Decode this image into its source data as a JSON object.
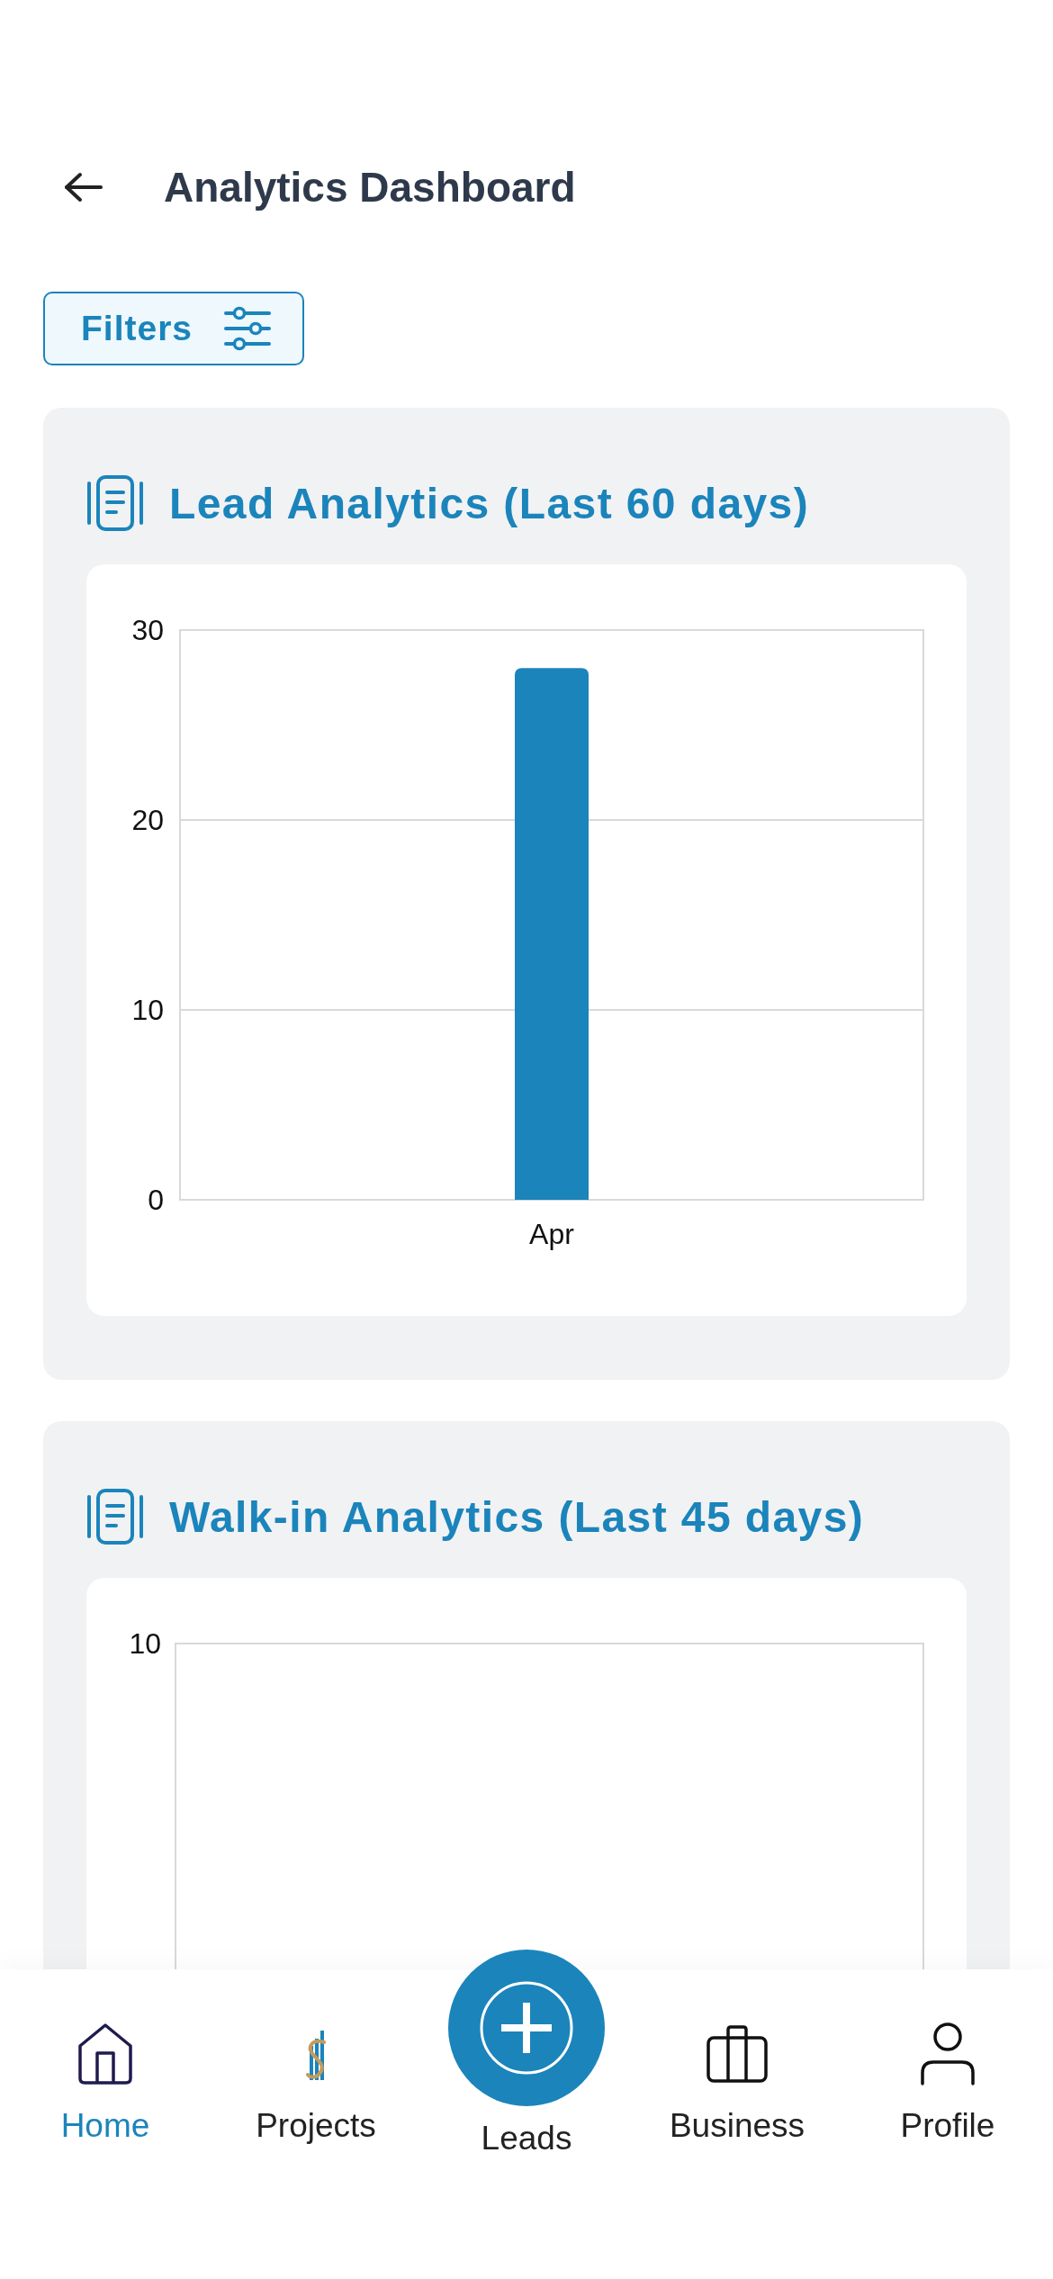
{
  "header": {
    "title": "Analytics Dashboard"
  },
  "filters_button": {
    "label": "Filters"
  },
  "cards": [
    {
      "title": "Lead Analytics (Last 60 days)",
      "chart_data": {
        "type": "bar",
        "categories": [
          "Apr"
        ],
        "values": [
          28
        ],
        "ylim": [
          0,
          30
        ],
        "yticks": [
          0,
          10,
          20,
          30
        ]
      }
    },
    {
      "title": "Walk-in Analytics (Last 45 days)",
      "chart": {
        "y_tick_labels": [
          "10"
        ]
      }
    }
  ],
  "bottom_nav": {
    "items": [
      {
        "label": "Home",
        "kind": "tab",
        "selected": true
      },
      {
        "label": "Projects",
        "kind": "tab",
        "selected": false
      },
      {
        "label": "Leads",
        "kind": "action",
        "selected": false
      },
      {
        "label": "Business",
        "kind": "tab",
        "selected": false
      },
      {
        "label": "Profile",
        "kind": "tab",
        "selected": false
      }
    ]
  }
}
